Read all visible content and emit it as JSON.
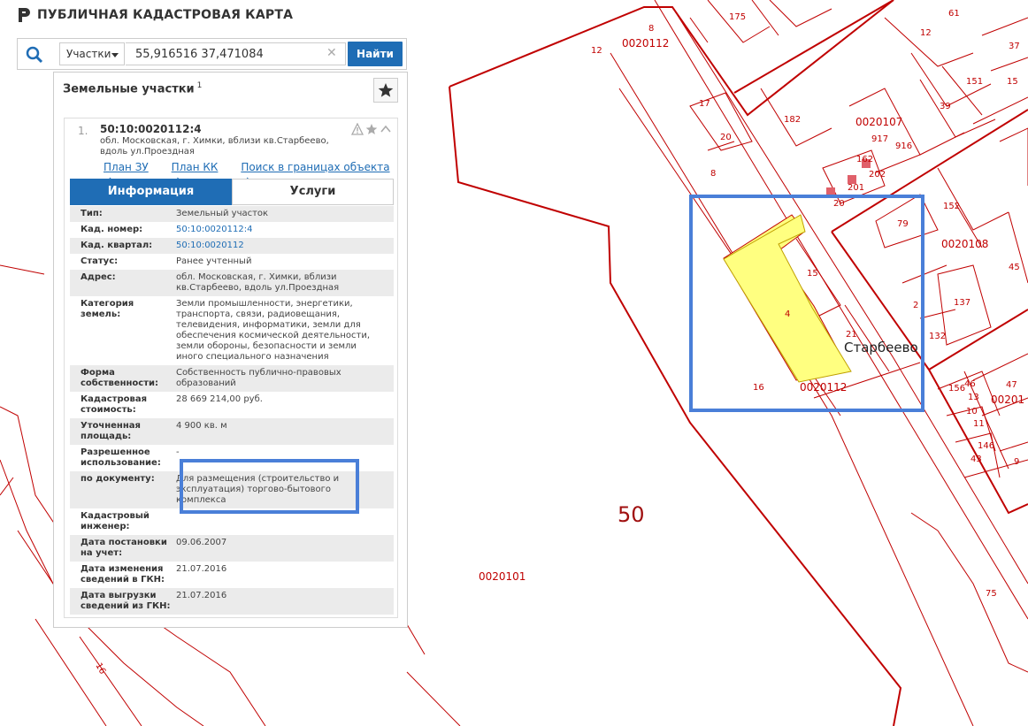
{
  "app": {
    "title": "ПУБЛИЧНАЯ КАДАСТРОВАЯ КАРТА",
    "logo_icon": "pkk-logo-icon"
  },
  "search": {
    "type_label": "Участки",
    "query": "55,916516 37,471084",
    "button_label": "Найти"
  },
  "panel": {
    "title": "Земельные участки",
    "count": "1",
    "card": {
      "number": "1.",
      "cadastral_number": "50:10:0020112:4",
      "address": "обл. Московская, г. Химки, вблизи кв.Старбеево, вдоль ул.Проездная",
      "links": [
        "План ЗУ →",
        "План КК →",
        "Поиск в границах объекта →"
      ],
      "tabs": [
        "Информация",
        "Услуги"
      ]
    },
    "rows": [
      {
        "key": "Тип:",
        "value": "Земельный участок"
      },
      {
        "key": "Кад. номер:",
        "value": "50:10:0020112:4",
        "link": true
      },
      {
        "key": "Кад. квартал:",
        "value": "50:10:0020112",
        "link": true
      },
      {
        "key": "Статус:",
        "value": "Ранее учтенный"
      },
      {
        "key": "Адрес:",
        "value": "обл. Московская, г. Химки, вблизи кв.Старбеево, вдоль ул.Проездная"
      },
      {
        "key": "Категория земель:",
        "value": "Земли промышленности, энергетики, транспорта, связи, радиовещания, телевидения, информатики, земли для обеспечения космической деятельности, земли обороны, безопасности и земли иного специального назначения"
      },
      {
        "key": "Форма собственности:",
        "value": "Собственность публично-правовых образований"
      },
      {
        "key": "Кадастровая стоимость:",
        "value": "28 669 214,00 руб."
      },
      {
        "key": "Уточненная площадь:",
        "value": "4 900 кв. м"
      },
      {
        "key": "Разрешенное использование:",
        "value": "-"
      },
      {
        "key": "по документу:",
        "value": "Для размещения (строительство и эксплуатация) торгово-бытового комплекса"
      },
      {
        "key": "Кадастровый инженер:",
        "value": ""
      },
      {
        "key": "Дата постановки на учет:",
        "value": "09.06.2007"
      },
      {
        "key": "Дата изменения сведений в ГКН:",
        "value": "21.07.2016"
      },
      {
        "key": "Дата выгрузки сведений из ГКН:",
        "value": "21.07.2016"
      }
    ]
  },
  "map": {
    "region_label": "50",
    "quarters": [
      "0020112",
      "0020107",
      "0020108",
      "0020101",
      "0020112",
      "00201"
    ],
    "settlement": "Старбеево",
    "parcel_labels": [
      "175",
      "61",
      "37",
      "12",
      "151",
      "15",
      "39",
      "182",
      "17",
      "20",
      "8",
      "16",
      "8",
      "916",
      "917",
      "162",
      "202",
      "201",
      "20",
      "152",
      "79",
      "45",
      "15",
      "4",
      "137",
      "2",
      "21",
      "132",
      "16",
      "156",
      "12",
      "46",
      "47",
      "13",
      "10",
      "11",
      "39",
      "146",
      "43",
      "9",
      "75",
      "16"
    ],
    "colors": {
      "boundary": "#c00000",
      "selected_fill": "#ffff80",
      "highlight": "#4a7fd8"
    }
  }
}
